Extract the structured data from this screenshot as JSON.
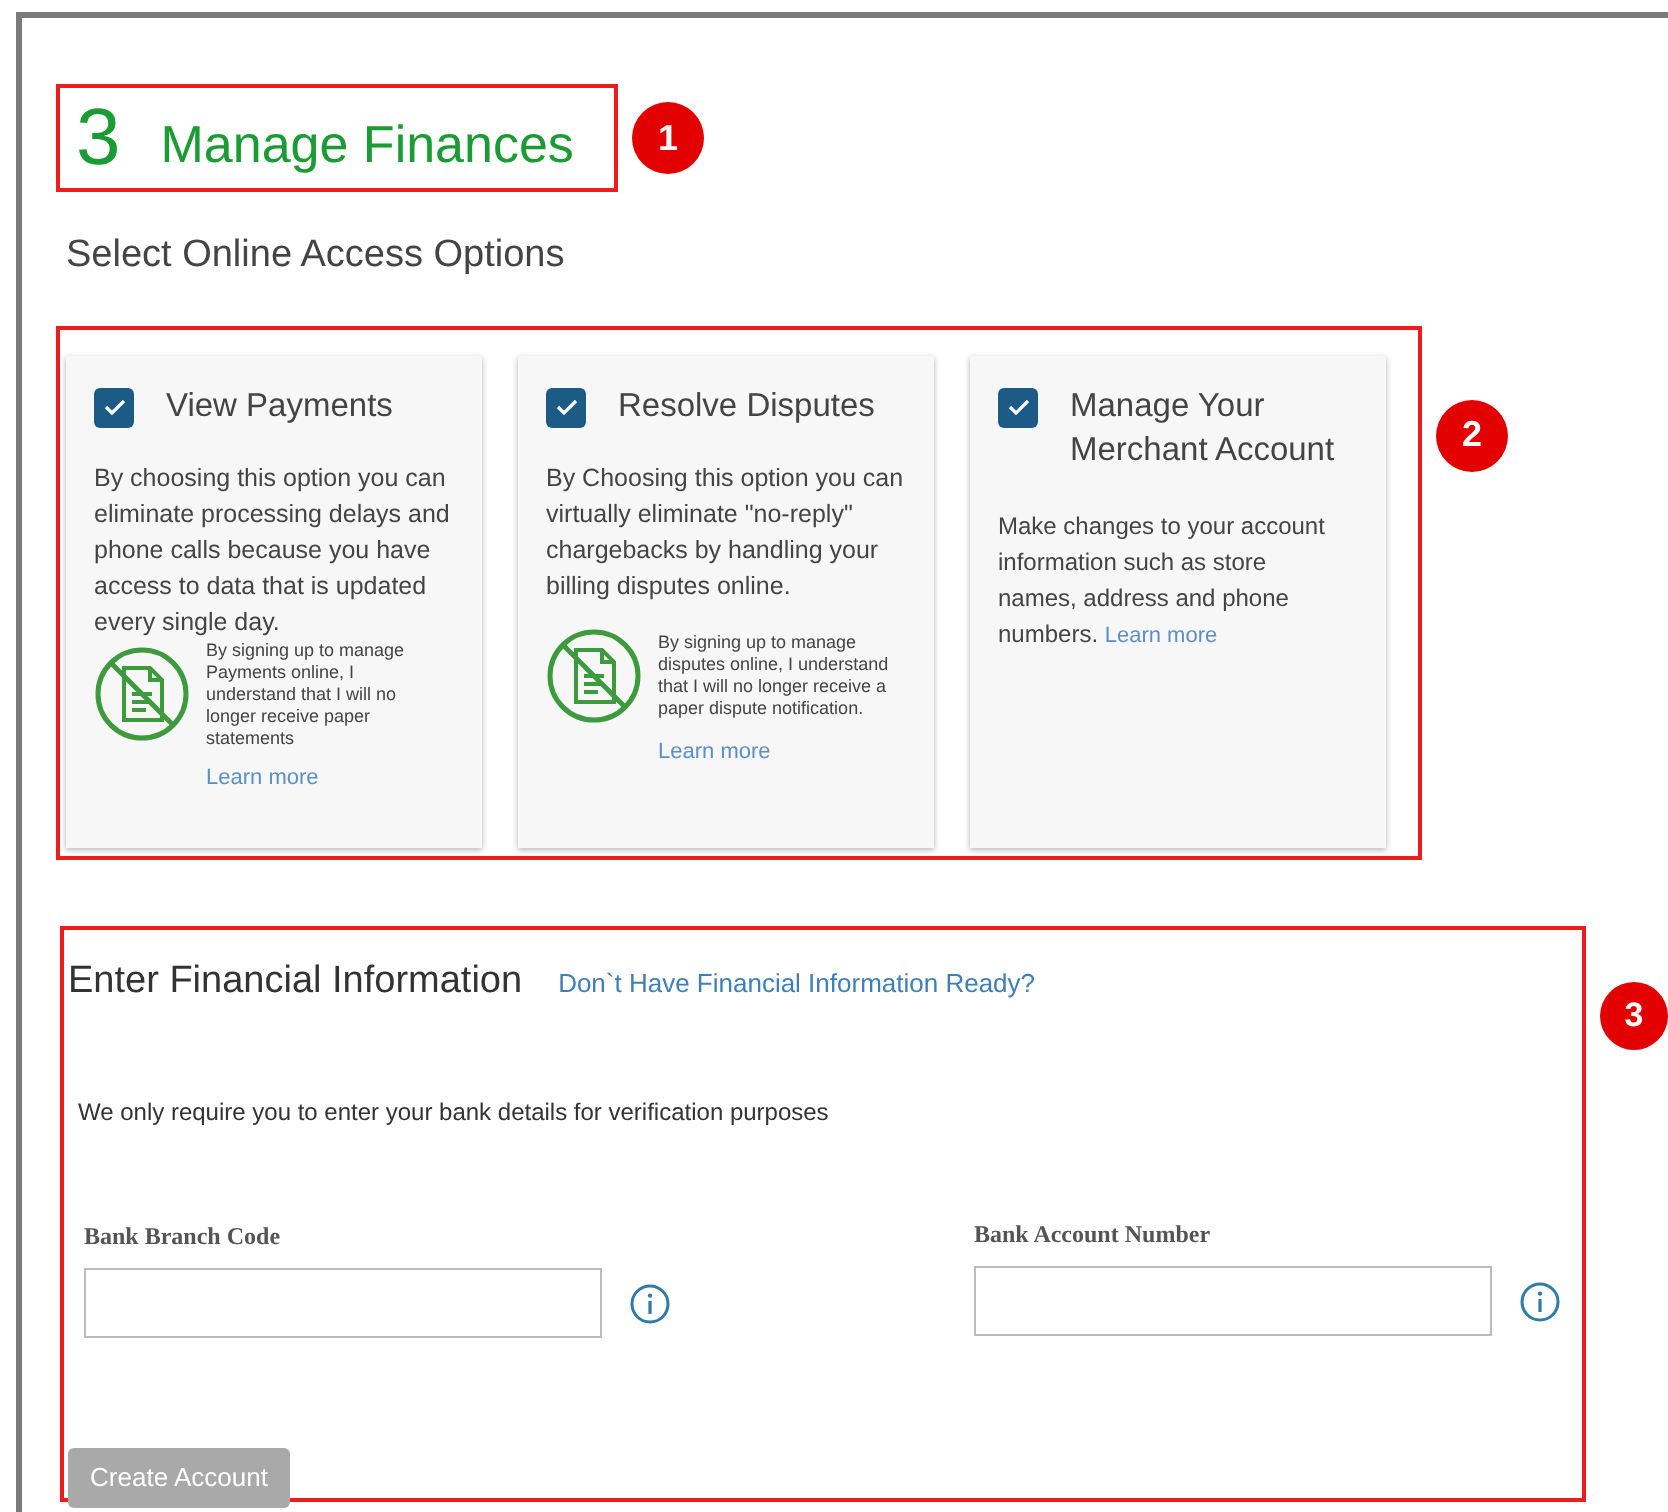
{
  "heading": {
    "number": "3",
    "title": "Manage Finances",
    "badge": "1"
  },
  "subheading": "Select Online Access Options",
  "options": {
    "badge": "2",
    "cards": [
      {
        "kind": "with_note",
        "checked": true,
        "title": "View Payments",
        "description": "By choosing this option you can eliminate processing delays and phone calls because you have access to data that is updated every single day.",
        "note": "By signing up to manage Payments online, I understand that I will no longer receive paper statements",
        "link": "Learn more"
      },
      {
        "kind": "with_note",
        "checked": true,
        "title": "Resolve Disputes",
        "description": "By Choosing this option you can virtually eliminate \"no-reply\" chargebacks by handling your billing disputes online.",
        "note": "By signing up to manage disputes online, I understand that I will no longer receive a paper dispute notification.",
        "link": "Learn more"
      },
      {
        "kind": "inline_link",
        "checked": true,
        "title": "Manage Your Merchant Account",
        "description": "Make changes to your account information such as store names, address and phone numbers.",
        "link": "Learn more"
      }
    ]
  },
  "financial": {
    "badge": "3",
    "title": "Enter Financial Information",
    "help_link": "Don`t Have Financial Information Ready?",
    "intro": "We only require you to enter your bank details for verification purposes",
    "fields": [
      {
        "label": "Bank Branch Code"
      },
      {
        "label": "Bank Account Number"
      }
    ],
    "submit": {
      "label": "Create Account",
      "disabled": true
    }
  }
}
